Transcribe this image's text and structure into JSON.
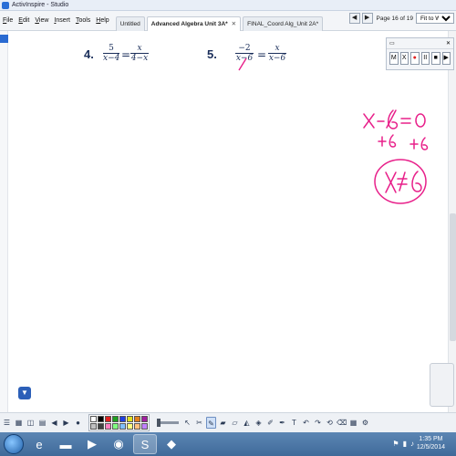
{
  "window": {
    "title": "ActivInspire - Studio"
  },
  "menu": [
    {
      "pre": "",
      "u": "F",
      "post": "ile"
    },
    {
      "pre": "",
      "u": "E",
      "post": "dit"
    },
    {
      "pre": "",
      "u": "V",
      "post": "iew"
    },
    {
      "pre": "",
      "u": "I",
      "post": "nsert"
    },
    {
      "pre": "",
      "u": "T",
      "post": "ools"
    },
    {
      "pre": "",
      "u": "H",
      "post": "elp"
    }
  ],
  "tabs": [
    {
      "label": "Untitled",
      "active": false
    },
    {
      "label": "Advanced Algebra Unit 3A*",
      "active": true
    },
    {
      "label": "FINAL_Coord Alg_Unit 2A*",
      "active": false
    }
  ],
  "pager": {
    "page_text": "Page 16 of 19",
    "zoom": "Fit to Width"
  },
  "problems": [
    {
      "number": "4.",
      "left_num": "5",
      "left_den": "x−4",
      "equals": "=",
      "right_num": "x",
      "right_den": "4−x"
    },
    {
      "number": "5.",
      "left_num": "−2",
      "left_den": "x−6",
      "equals": "=",
      "right_num": "x",
      "right_den": "x−6"
    }
  ],
  "recorder": {
    "buttons": [
      "M",
      "X",
      "●",
      "II",
      "■",
      "▶"
    ]
  },
  "ink": {
    "color": "#e8208a",
    "line1": "x − 6 = 0",
    "line2": "+6   +6",
    "answer": "x ≠ 6"
  },
  "palette": [
    "#ffffff",
    "#000000",
    "#e02020",
    "#20a020",
    "#2040e0",
    "#e0e020",
    "#e08020",
    "#a020a0",
    "#c0c0c0",
    "#404040",
    "#ff80c0",
    "#80ff80",
    "#80c0ff",
    "#ffff80",
    "#ffc080",
    "#c080ff"
  ],
  "taskbar": {
    "time": "1:35 PM",
    "date": "12/5/2014",
    "apps": [
      "ie-icon",
      "folder-icon",
      "media-icon",
      "chrome-icon",
      "skype-icon",
      "activinspire-icon"
    ]
  }
}
